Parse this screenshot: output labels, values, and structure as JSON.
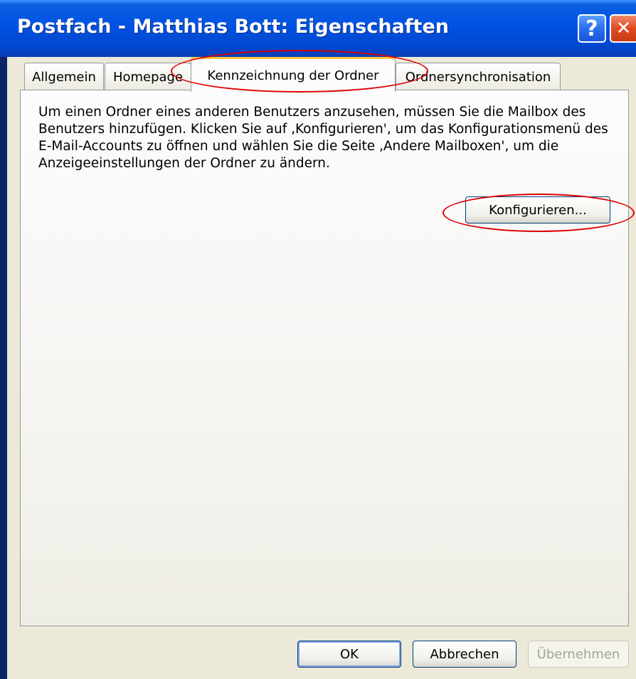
{
  "window": {
    "title": "Postfach - Matthias Bott: Eigenschaften",
    "help_glyph": "?",
    "close_glyph": "✕"
  },
  "tabs": [
    {
      "label": "Allgemein",
      "active": false
    },
    {
      "label": "Homepage",
      "active": false
    },
    {
      "label": "Kennzeichnung der Ordner",
      "active": true
    },
    {
      "label": "Ordnersynchronisation",
      "active": false
    }
  ],
  "panel": {
    "description": "Um einen Ordner eines anderen Benutzers anzusehen, müssen Sie die Mailbox des Benutzers hinzufügen. Klicken Sie auf ‚Konfigurieren', um das Konfigurationsmenü des E-Mail-Accounts zu öffnen und wählen Sie die Seite ‚Andere Mailboxen', um die Anzeigeeinstellungen der Ordner zu ändern.",
    "configure_label": "Konfigurieren..."
  },
  "footer": {
    "ok_label": "OK",
    "cancel_label": "Abbrechen",
    "apply_label": "Übernehmen",
    "apply_enabled": false
  },
  "colors": {
    "titlebar": "#0052e3",
    "dialog_bg": "#ece9d8",
    "annotation": "#e00000",
    "active_tab_accent": "#ffc83c"
  }
}
